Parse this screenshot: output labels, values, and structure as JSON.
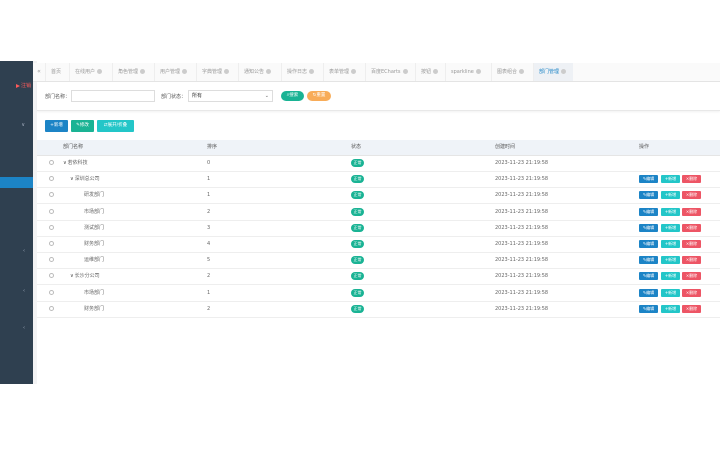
{
  "sidebar": {
    "logout_label": "注销",
    "active_item_index": 3
  },
  "tabs": [
    {
      "label": "首页",
      "closable": false
    },
    {
      "label": "在线用户",
      "closable": true
    },
    {
      "label": "角色管理",
      "closable": true
    },
    {
      "label": "用户管理",
      "closable": true
    },
    {
      "label": "字典管理",
      "closable": true
    },
    {
      "label": "通知公告",
      "closable": true
    },
    {
      "label": "操作日志",
      "closable": true
    },
    {
      "label": "表单管理",
      "closable": true
    },
    {
      "label": "百度ECharts",
      "closable": true
    },
    {
      "label": "按钮",
      "closable": true
    },
    {
      "label": "sparkline",
      "closable": true
    },
    {
      "label": "图表组合",
      "closable": true
    },
    {
      "label": "部门管理",
      "closable": true,
      "active": true
    }
  ],
  "search": {
    "dept_name_label": "部门名称：",
    "dept_name_value": "",
    "status_label": "部门状态：",
    "status_value": "所有",
    "search_button": "搜索",
    "reset_button": "重置"
  },
  "toolbar": {
    "add_label": "新增",
    "edit_label": "修改",
    "expand_label": "展开/折叠"
  },
  "table": {
    "columns": [
      "部门名称",
      "排序",
      "状态",
      "创建时间",
      "操作"
    ],
    "rows": [
      {
        "name": "若依科技",
        "level": 0,
        "toggle": "∨",
        "order": "0",
        "status": "正常",
        "created": "2023-11-23 21:19:58",
        "actions": false
      },
      {
        "name": "深圳总公司",
        "level": 1,
        "toggle": "∨",
        "order": "1",
        "status": "正常",
        "created": "2023-11-23 21:19:58",
        "actions": true
      },
      {
        "name": "研发部门",
        "level": 2,
        "toggle": "",
        "order": "1",
        "status": "正常",
        "created": "2023-11-23 21:19:58",
        "actions": true
      },
      {
        "name": "市场部门",
        "level": 2,
        "toggle": "",
        "order": "2",
        "status": "正常",
        "created": "2023-11-23 21:19:58",
        "actions": true
      },
      {
        "name": "测试部门",
        "level": 2,
        "toggle": "",
        "order": "3",
        "status": "正常",
        "created": "2023-11-23 21:19:58",
        "actions": true
      },
      {
        "name": "财务部门",
        "level": 2,
        "toggle": "",
        "order": "4",
        "status": "正常",
        "created": "2023-11-23 21:19:58",
        "actions": true
      },
      {
        "name": "运维部门",
        "level": 2,
        "toggle": "",
        "order": "5",
        "status": "正常",
        "created": "2023-11-23 21:19:58",
        "actions": true
      },
      {
        "name": "长沙分公司",
        "level": 1,
        "toggle": "∨",
        "order": "2",
        "status": "正常",
        "created": "2023-11-23 21:19:58",
        "actions": true
      },
      {
        "name": "市场部门",
        "level": 2,
        "toggle": "",
        "order": "1",
        "status": "正常",
        "created": "2023-11-23 21:19:58",
        "actions": true
      },
      {
        "name": "财务部门",
        "level": 2,
        "toggle": "",
        "order": "2",
        "status": "正常",
        "created": "2023-11-23 21:19:58",
        "actions": true
      }
    ],
    "action_labels": {
      "edit": "编辑",
      "add": "新增",
      "delete": "删除"
    }
  },
  "colors": {
    "sidebar_bg": "#2f4050",
    "primary": "#1c84c6",
    "success": "#1ab394",
    "info": "#23c6c8",
    "danger": "#ed5565",
    "warning": "#f8ac59"
  }
}
